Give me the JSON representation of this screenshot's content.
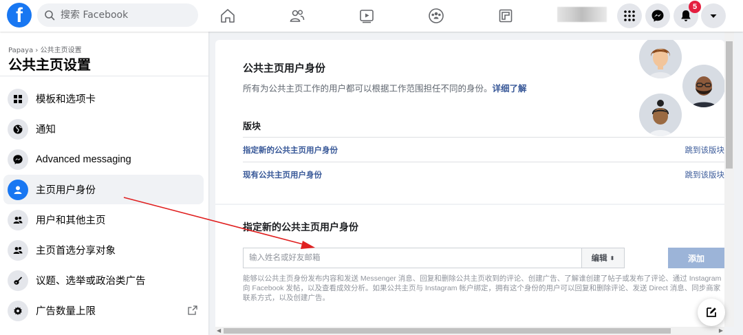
{
  "topbar": {
    "logo": "f",
    "search_placeholder": "搜索 Facebook",
    "nav_icons": [
      "home-icon",
      "friends-icon",
      "watch-icon",
      "groups-icon",
      "gaming-icon"
    ],
    "notification_count": "5"
  },
  "sidebar": {
    "breadcrumb": "Papaya › 公共主页设置",
    "title": "公共主页设置",
    "items": [
      {
        "label": "模板和选项卡",
        "icon": "grid-icon"
      },
      {
        "label": "通知",
        "icon": "globe-icon"
      },
      {
        "label": "Advanced messaging",
        "icon": "messenger-icon"
      },
      {
        "label": "主页用户身份",
        "icon": "person-icon",
        "active": true
      },
      {
        "label": "用户和其他主页",
        "icon": "people-icon"
      },
      {
        "label": "主页首选分享对象",
        "icon": "people-icon"
      },
      {
        "label": "议题、选举或政治类广告",
        "icon": "guitar-icon"
      },
      {
        "label": "广告数量上限",
        "icon": "gear-icon"
      }
    ]
  },
  "roles": {
    "title": "公共主页用户身份",
    "description": "所有为公共主页工作的用户都可以根据工作范围担任不同的身份。",
    "learn_more": "详细了解",
    "section_label": "版块",
    "sections": [
      {
        "label": "指定新的公共主页用户身份",
        "jump": "跳到该版块"
      },
      {
        "label": "现有公共主页用户身份",
        "jump": "跳到该版块"
      }
    ]
  },
  "assign": {
    "title": "指定新的公共主页用户身份",
    "input_placeholder": "输入姓名或好友邮箱",
    "role_value": "编辑",
    "add_label": "添加",
    "help_text": "能够以公共主页身份发布内容和发送 Messenger 消息、回复和删除公共主页收到的评论、创建广告、了解谁创建了帖子或发布了评论、通过 Instagram 向 Facebook 发帖，以及查看成效分析。如果公共主页与 Instagram 帐户绑定，拥有这个身份的用户可以回复和删除评论、发送 Direct 消息、同步商家联系方式，以及创建广告。"
  },
  "colors": {
    "brand": "#1877f2",
    "link": "#385898",
    "badge": "#e41e3f",
    "annotation_arrow": "#e02020"
  }
}
